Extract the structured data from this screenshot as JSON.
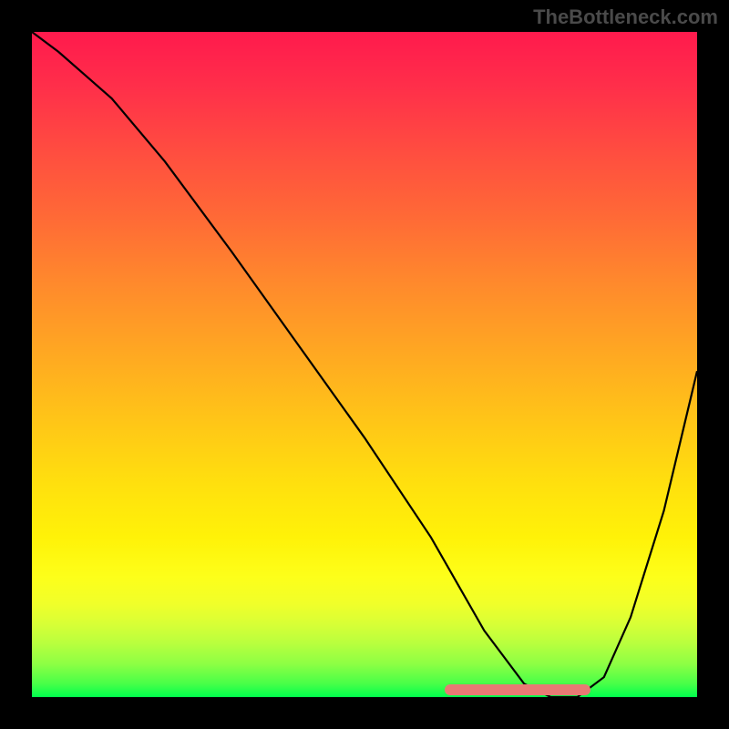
{
  "watermark": "TheBottleneck.com",
  "colors": {
    "background": "#000000",
    "curve": "#000000",
    "highlight": "#e87a74",
    "gradient_top": "#ff1a4d",
    "gradient_bottom": "#00ff4d"
  },
  "chart_data": {
    "type": "line",
    "title": "",
    "xlabel": "",
    "ylabel": "",
    "xlim": [
      0,
      100
    ],
    "ylim": [
      0,
      100
    ],
    "legend": false,
    "grid": false,
    "annotations": [
      "TheBottleneck.com"
    ],
    "series": [
      {
        "name": "bottleneck-curve",
        "x": [
          0,
          4,
          8,
          12,
          20,
          30,
          40,
          50,
          60,
          64,
          68,
          74,
          78,
          82,
          86,
          90,
          95,
          100
        ],
        "y": [
          100,
          97,
          93.5,
          90,
          80.5,
          67,
          53,
          39,
          24,
          17,
          10,
          2,
          0,
          0,
          3,
          12,
          28,
          49
        ]
      }
    ],
    "highlight_region": {
      "x_start": 62,
      "x_end": 84,
      "y": 0.5,
      "description": "optimal-range-marker"
    }
  }
}
